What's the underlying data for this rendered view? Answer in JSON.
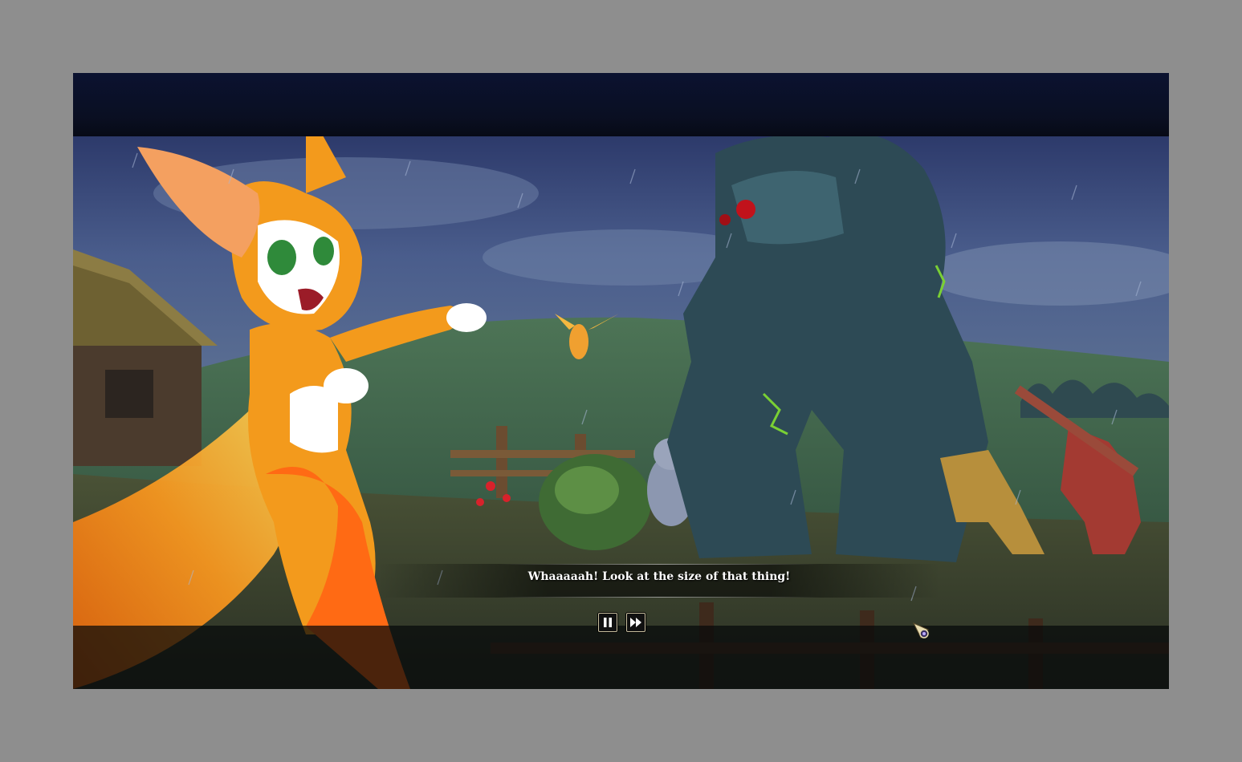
{
  "cutscene": {
    "subtitle": "Whaaaaah! Look at the size of that thing!",
    "pause_icon": "pause-icon",
    "fast_forward_icon": "fast-forward-icon"
  },
  "colors": {
    "letterbox": "#0a0f22",
    "outer_background": "#8e8e8e",
    "subtitle_text": "#ffffff"
  }
}
